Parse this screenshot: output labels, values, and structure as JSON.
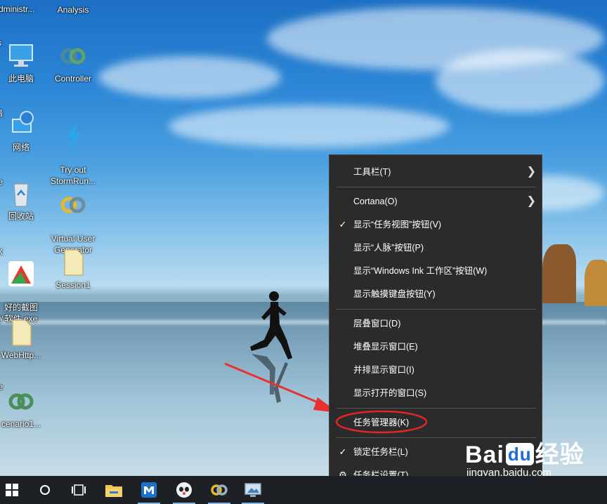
{
  "desktop": {
    "left_clipped_labels": [
      "dministr...",
      "s",
      "脑",
      "e",
      "X",
      "w",
      "e",
      "ft",
      "ft"
    ],
    "icons": [
      {
        "name": "this-pc",
        "label": "此电脑"
      },
      {
        "name": "network",
        "label": "网络"
      },
      {
        "name": "recycle-bin",
        "label": "回收站"
      },
      {
        "name": "screenshot-exe",
        "label": "好的截图\n软件.exe"
      },
      {
        "name": "webhttp-file",
        "label": "WebHttp..."
      },
      {
        "name": "scenario",
        "label": "cenario1..."
      },
      {
        "name": "analysis",
        "label": "Analysis"
      },
      {
        "name": "controller",
        "label": "Controller"
      },
      {
        "name": "try-stormrunner",
        "label": "Try out\nStormRun..."
      },
      {
        "name": "virtual-user-generator",
        "label": "Virtual User\nGenerator"
      },
      {
        "name": "session1",
        "label": "Session1"
      }
    ]
  },
  "context_menu": {
    "items": [
      {
        "label": "工具栏(T)",
        "submenu": true,
        "checked": false
      },
      {
        "label": "Cortana(O)",
        "submenu": true,
        "checked": false
      },
      {
        "label": "显示“任务视图”按钮(V)",
        "submenu": false,
        "checked": true
      },
      {
        "label": "显示“人脉”按钮(P)",
        "submenu": false,
        "checked": false
      },
      {
        "label": "显示“Windows Ink 工作区”按钮(W)",
        "submenu": false,
        "checked": false
      },
      {
        "label": "显示触摸键盘按钮(Y)",
        "submenu": false,
        "checked": false
      },
      {
        "label": "层叠窗口(D)",
        "submenu": false,
        "checked": false
      },
      {
        "label": "堆叠显示窗口(E)",
        "submenu": false,
        "checked": false
      },
      {
        "label": "并排显示窗口(I)",
        "submenu": false,
        "checked": false
      },
      {
        "label": "显示打开的窗口(S)",
        "submenu": false,
        "checked": false
      },
      {
        "label": "任务管理器(K)",
        "submenu": false,
        "checked": false,
        "highlighted": true
      },
      {
        "label": "锁定任务栏(L)",
        "submenu": false,
        "checked": true
      },
      {
        "label": "任务栏设置(T)",
        "submenu": false,
        "checked": false,
        "icon": "gear-icon"
      }
    ],
    "highlight_color": "#e0262a"
  },
  "taskbar": {
    "buttons": [
      "start-windows-icon",
      "cortana-circle-icon",
      "task-view-icon",
      "file-explorer-icon",
      "maxthon-browser-icon",
      "panda-app-icon",
      "loadrunner-icon",
      "screenshot-tool-icon"
    ]
  },
  "watermark": {
    "brand_prefix": "Bai",
    "brand_mid": "du",
    "brand_suffix": "经验",
    "url": "jingyan.baidu.com"
  }
}
